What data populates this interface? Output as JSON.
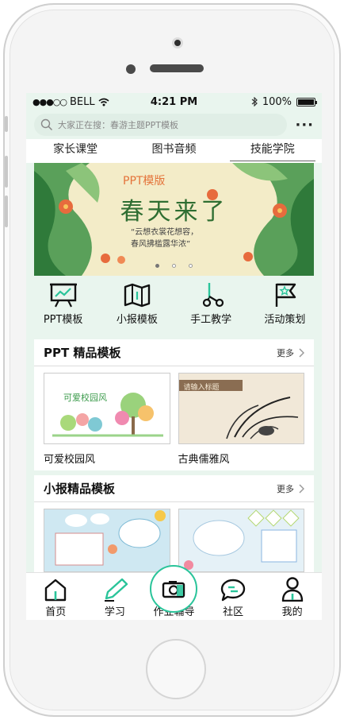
{
  "status_bar": {
    "carrier": "BELL",
    "time": "4:21 PM",
    "battery": "100%"
  },
  "search": {
    "placeholder": "大家正在搜：春游主题PPT模板"
  },
  "tabs": [
    {
      "label": "家长课堂"
    },
    {
      "label": "图书音频"
    },
    {
      "label": "技能学院"
    }
  ],
  "banner": {
    "tag": "PPT模版",
    "title": "春天来了",
    "subtitle_line1": "“云想衣裳花想容，",
    "subtitle_line2": "春风拂槛露华浓”",
    "page_count": 3,
    "active_page": 0
  },
  "categories": [
    {
      "label": "PPT模板",
      "icon": "presentation-board-icon"
    },
    {
      "label": "小报模板",
      "icon": "map-icon"
    },
    {
      "label": "手工教学",
      "icon": "scissors-icon"
    },
    {
      "label": "活动策划",
      "icon": "flag-icon"
    }
  ],
  "sections": [
    {
      "title": "PPT 精品模板",
      "more": "更多",
      "items": [
        {
          "label": "可爱校园风",
          "thumb_text": "可爱校园风"
        },
        {
          "label": "古典儒雅风",
          "thumb_text": "请输入标题"
        }
      ]
    },
    {
      "title": "小报精品模板",
      "more": "更多",
      "items": [
        {
          "label": ""
        },
        {
          "label": ""
        }
      ]
    }
  ],
  "tabbar": [
    {
      "label": "首页",
      "icon": "home-icon"
    },
    {
      "label": "学习",
      "icon": "pen-icon"
    },
    {
      "label": "作业辅导",
      "icon": "camera-icon"
    },
    {
      "label": "社区",
      "icon": "chat-icon"
    },
    {
      "label": "我的",
      "icon": "user-icon"
    }
  ],
  "colors": {
    "accent": "#2ac49a",
    "screen_bg": "#e9f5ee",
    "banner_green": "#2f6e32",
    "banner_orange": "#e4733a"
  }
}
